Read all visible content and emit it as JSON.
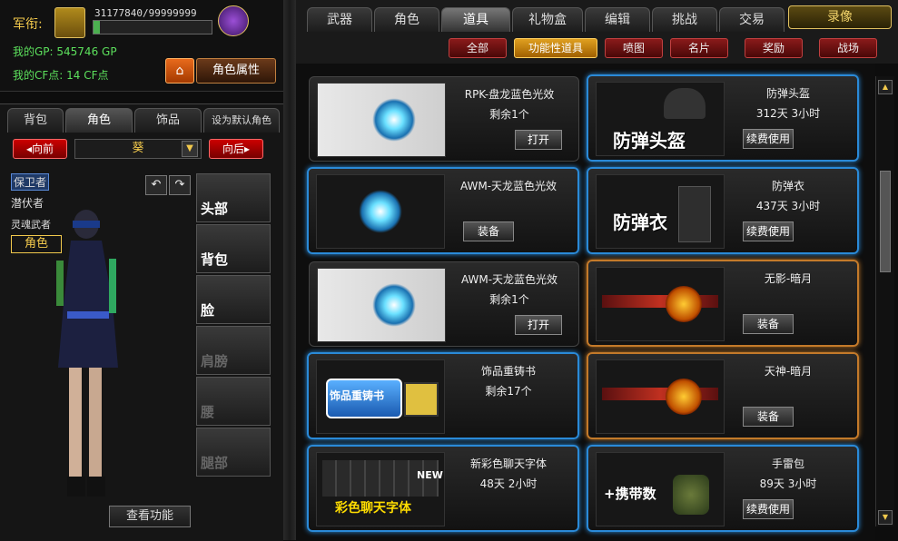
{
  "profile": {
    "rank_label": "军衔:",
    "exp_text": "31177840/99999999",
    "exp_progress": 0.05,
    "gp_text": "我的GP: 545746 GP",
    "cf_text": "我的CF点: 14 CF点",
    "home_icon": "home-icon",
    "attr_button": "角色属性"
  },
  "left_tabs": [
    "背包",
    "角色",
    "饰品",
    "设为默认角色"
  ],
  "left_tab_active": 1,
  "char_nav": {
    "prev": "◂向前",
    "next": "向后▸",
    "selected": "葵"
  },
  "roles": [
    "保卫者",
    "潜伏者",
    "灵魂武者"
  ],
  "role_active": "角色",
  "slots": [
    {
      "label": "头部",
      "dim": false
    },
    {
      "label": "背包",
      "dim": false
    },
    {
      "label": "脸",
      "dim": false
    },
    {
      "label": "肩膀",
      "dim": true
    },
    {
      "label": "腰",
      "dim": true
    },
    {
      "label": "腿部",
      "dim": true
    }
  ],
  "view_button": "查看功能",
  "top_tabs": [
    "武器",
    "角色",
    "道具",
    "礼物盒",
    "编辑",
    "挑战",
    "交易"
  ],
  "top_tab_active": 2,
  "record_button": "录像",
  "sub_tabs": [
    "全部",
    "功能性道具",
    "喷图",
    "名片",
    "奖励",
    "战场"
  ],
  "sub_tab_active": 1,
  "items": [
    {
      "name": "RPK-盘龙蓝色光效",
      "sub": "剩余1个",
      "button": "打开",
      "style": "ticket",
      "border": "none",
      "overlay": ""
    },
    {
      "name": "防弹头盔",
      "sub": "312天 3小时",
      "button": "续费使用",
      "style": "dark",
      "border": "blue",
      "overlay": "防弹头盔"
    },
    {
      "name": "AWM-天龙蓝色光效",
      "sub": "",
      "button": "装备",
      "style": "dark",
      "border": "blue",
      "overlay": ""
    },
    {
      "name": "防弹衣",
      "sub": "437天 3小时",
      "button": "续费使用",
      "style": "dark",
      "border": "blue",
      "overlay": "防弹衣"
    },
    {
      "name": "AWM-天龙蓝色光效",
      "sub": "剩余1个",
      "button": "打开",
      "style": "ticket",
      "border": "none",
      "overlay": ""
    },
    {
      "name": "无影-暗月",
      "sub": "",
      "button": "装备",
      "style": "weapon",
      "border": "orange",
      "overlay": ""
    },
    {
      "name": "饰品重铸书",
      "sub": "剩余17个",
      "button": "",
      "style": "book",
      "border": "blue",
      "overlay": "饰品重铸书"
    },
    {
      "name": "天神-暗月",
      "sub": "",
      "button": "装备",
      "style": "weapon",
      "border": "orange",
      "overlay": ""
    },
    {
      "name": "新彩色聊天字体",
      "sub": "48天 2小时",
      "button": "",
      "style": "keyboard",
      "border": "blue",
      "overlay": "彩色聊天字体"
    },
    {
      "name": "手雷包",
      "sub": "89天 3小时",
      "button": "续费使用",
      "style": "dark",
      "border": "blue",
      "overlay": "+携带数"
    }
  ]
}
